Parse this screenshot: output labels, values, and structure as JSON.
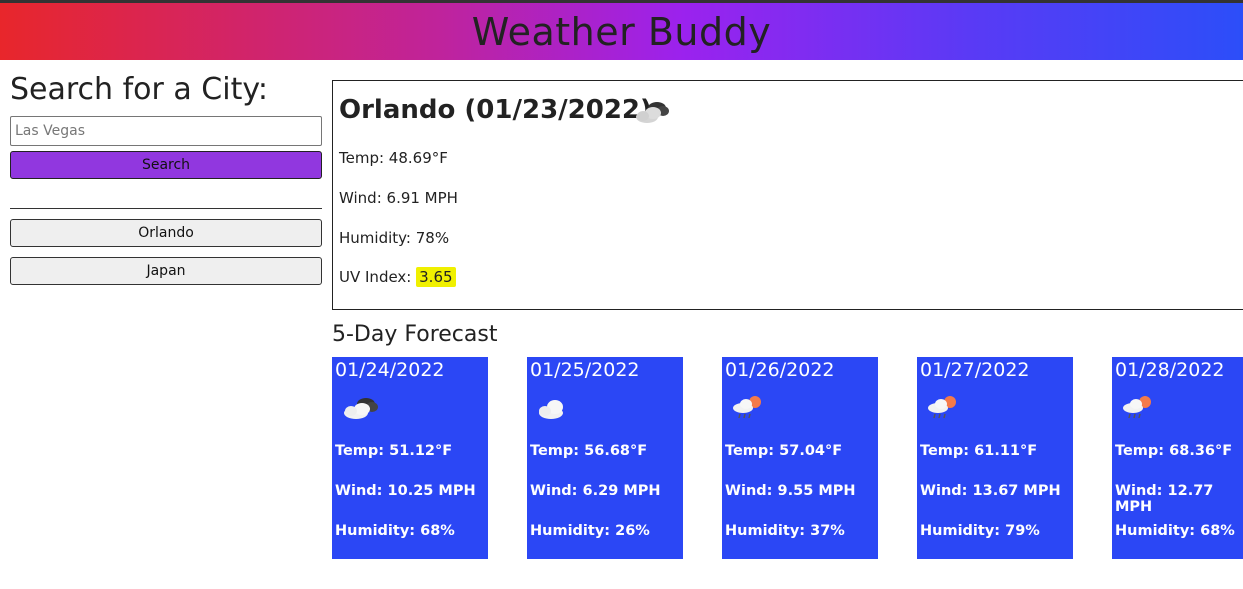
{
  "header": {
    "title": "Weather Buddy"
  },
  "search": {
    "title": "Search for a City:",
    "placeholder": "Las Vegas",
    "button_label": "Search"
  },
  "history": [
    {
      "label": "Orlando"
    },
    {
      "label": "Japan"
    }
  ],
  "current": {
    "title": "Orlando (01/23/2022)",
    "icon": "broken-clouds-icon",
    "temp": "Temp: 48.69°F",
    "wind": "Wind: 6.91 MPH",
    "humidity": "Humidity: 78%",
    "uv_label": "UV Index:",
    "uv_value": "3.65",
    "uv_color": "#f0f000"
  },
  "forecast": {
    "title": "5-Day Forecast",
    "card_color": "#2b47f5",
    "days": [
      {
        "date": "01/24/2022",
        "icon": "broken-clouds-icon",
        "temp": "Temp: 51.12°F",
        "wind": "Wind: 10.25 MPH",
        "humidity": "Humidity: 68%"
      },
      {
        "date": "01/25/2022",
        "icon": "cloud-icon",
        "temp": "Temp: 56.68°F",
        "wind": "Wind: 6.29 MPH",
        "humidity": "Humidity: 26%"
      },
      {
        "date": "01/26/2022",
        "icon": "rain-sun-icon",
        "temp": "Temp: 57.04°F",
        "wind": "Wind: 9.55 MPH",
        "humidity": "Humidity: 37%"
      },
      {
        "date": "01/27/2022",
        "icon": "rain-sun-icon",
        "temp": "Temp: 61.11°F",
        "wind": "Wind: 13.67 MPH",
        "humidity": "Humidity: 79%"
      },
      {
        "date": "01/28/2022",
        "icon": "rain-sun-icon",
        "temp": "Temp: 68.36°F",
        "wind": "Wind: 12.77 MPH",
        "humidity": "Humidity: 68%"
      }
    ]
  }
}
